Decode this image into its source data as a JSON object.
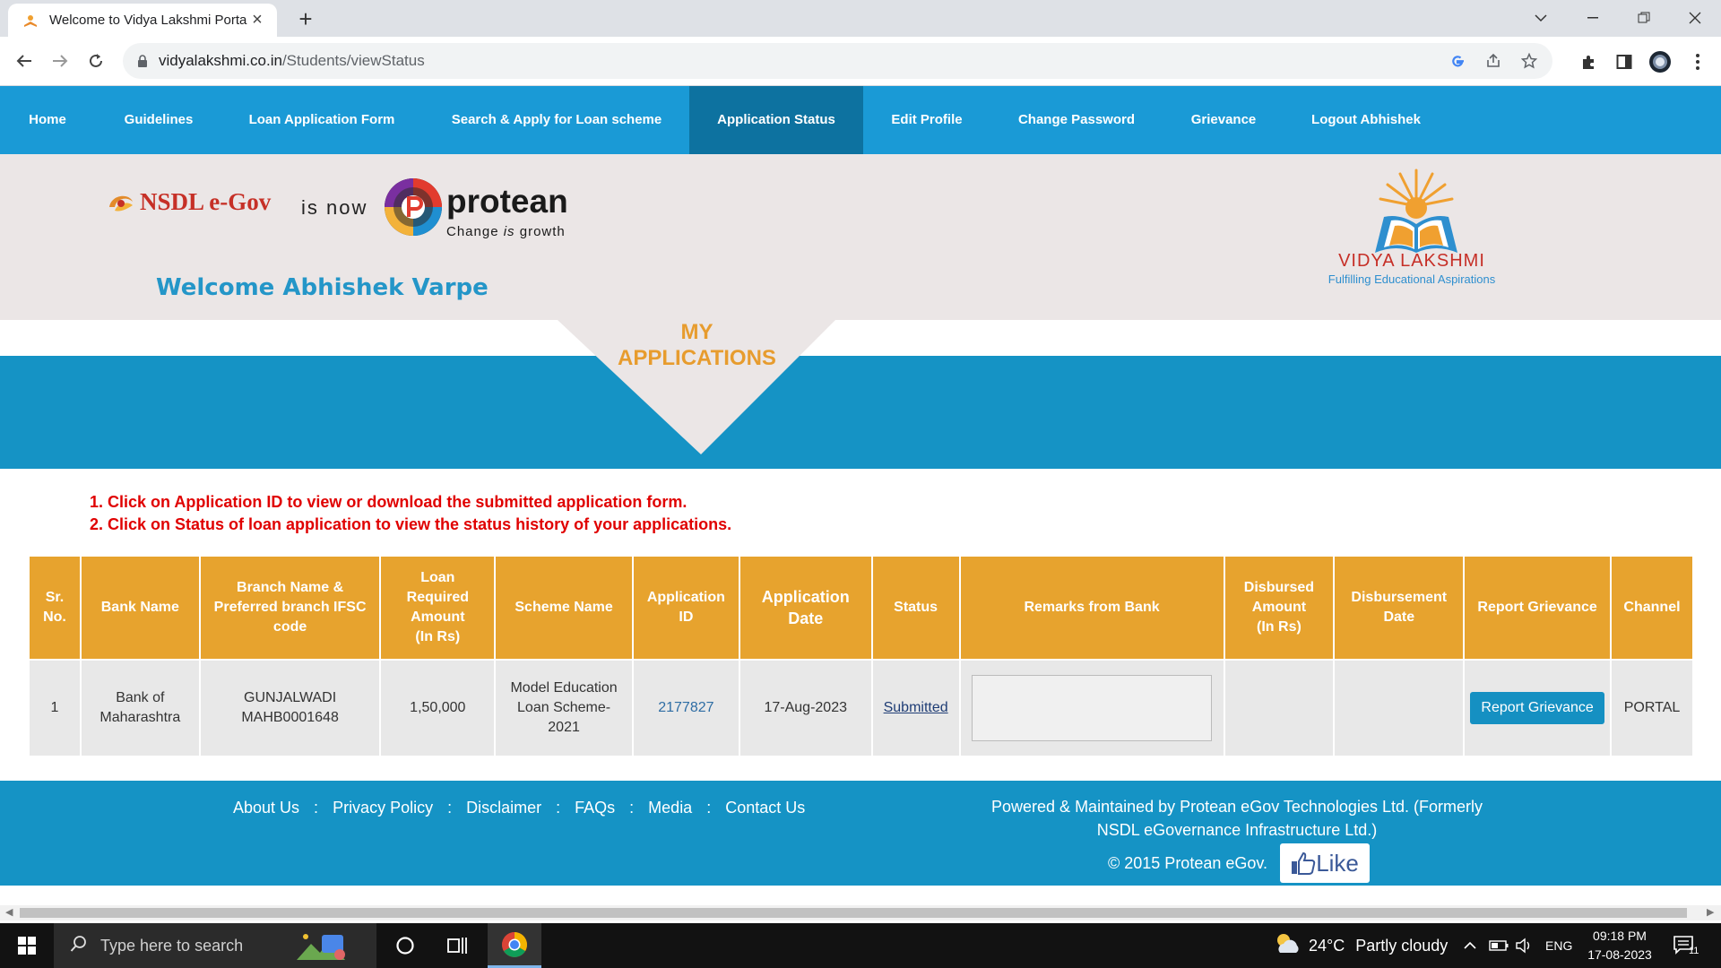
{
  "browser": {
    "tab_title": "Welcome to Vidya Lakshmi Porta",
    "url_domain": "vidyalakshmi.co.in",
    "url_path": "/Students/viewStatus"
  },
  "nav": {
    "items": [
      {
        "label": "Home"
      },
      {
        "label": "Guidelines"
      },
      {
        "label": "Loan Application Form"
      },
      {
        "label": "Search & Apply for Loan scheme"
      },
      {
        "label": "Application Status"
      },
      {
        "label": "Edit Profile"
      },
      {
        "label": "Change Password"
      },
      {
        "label": "Grievance"
      },
      {
        "label": "Logout Abhishek"
      }
    ],
    "active": "Application Status"
  },
  "header": {
    "nsdl_text": "NSDL e-Gov",
    "is_now": "is now",
    "protean_name": "protean",
    "protean_tagline_1": "Change ",
    "protean_tagline_em": "is",
    "protean_tagline_2": " growth",
    "welcome": "Welcome Abhishek Varpe",
    "vl_name": "VIDYA LAKSHMI",
    "vl_tagline": "Fulfilling Educational Aspirations"
  },
  "banner": {
    "line1": "MY",
    "line2": "APPLICATIONS"
  },
  "instructions": [
    "1. Click on Application ID to view or download the submitted application form.",
    "2. Click on Status of loan application to view the status history of your applications."
  ],
  "table": {
    "headers": {
      "sr_1": "Sr.",
      "sr_2": "No.",
      "bank": "Bank Name",
      "branch_1": "Branch Name &",
      "branch_2": "Preferred branch IFSC",
      "branch_3": "code",
      "loan_1": "Loan",
      "loan_2": "Required",
      "loan_3": "Amount",
      "loan_4": "(In Rs)",
      "scheme": "Scheme Name",
      "appid_1": "Application",
      "appid_2": "ID",
      "appdate_1": "Application",
      "appdate_2": "Date",
      "status": "Status",
      "remarks": "Remarks from Bank",
      "disb_amt_1": "Disbursed",
      "disb_amt_2": "Amount",
      "disb_amt_3": "(In Rs)",
      "disb_date_1": "Disbursement",
      "disb_date_2": "Date",
      "grievance": "Report Grievance",
      "channel": "Channel"
    },
    "rows": [
      {
        "sr": "1",
        "bank_1": "Bank of",
        "bank_2": "Maharashtra",
        "branch_name": "GUNJALWADI",
        "ifsc": "MAHB0001648",
        "amount": "1,50,000",
        "scheme_1": "Model Education",
        "scheme_2": "Loan Scheme-",
        "scheme_3": "2021",
        "app_id": "2177827",
        "app_date": "17-Aug-2023",
        "status": "Submitted",
        "remarks": "",
        "disbursed_amount": "",
        "disbursement_date": "",
        "grievance_button": "Report Grievance",
        "channel": "PORTAL"
      }
    ]
  },
  "footer": {
    "links": [
      "About Us",
      "Privacy Policy",
      "Disclaimer",
      "FAQs",
      "Media",
      "Contact Us"
    ],
    "separator": ":",
    "powered_1": "Powered & Maintained by Protean eGov Technologies Ltd. (Formerly",
    "powered_2": "NSDL eGovernance Infrastructure Ltd.)",
    "copyright": "© 2015 Protean eGov.",
    "like": "Like"
  },
  "taskbar": {
    "search_placeholder": "Type here to search",
    "weather_temp": "24°C",
    "weather_desc": "Partly cloudy",
    "lang": "ENG",
    "time": "09:18 PM",
    "date": "17-08-2023",
    "notif_count": "11"
  },
  "colors": {
    "nav_blue": "#1a9ad6",
    "nav_active": "#0d72a0",
    "table_header_orange": "#e7a32e",
    "banner_blue": "#1593c5",
    "instruction_red": "#e00000"
  }
}
